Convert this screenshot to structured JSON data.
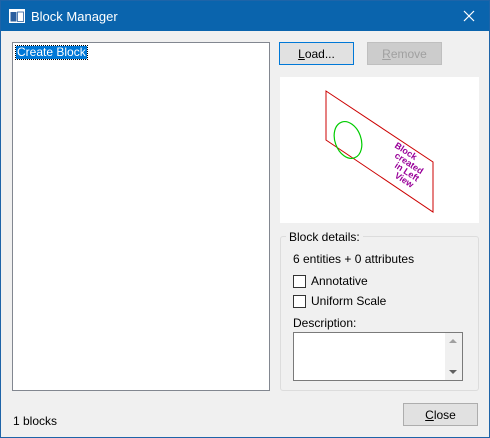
{
  "window": {
    "title": "Block Manager",
    "accent_color": "#0a64ad",
    "title_icon": "window-icon",
    "close_icon": "close-icon"
  },
  "blocks_list": {
    "items": [
      {
        "label": "Create Block",
        "selected": true
      }
    ]
  },
  "buttons": {
    "load": {
      "label_prefix": "",
      "label_mnemonic": "L",
      "label_rest": "oad..."
    },
    "remove": {
      "label_prefix": "",
      "label_mnemonic": "R",
      "label_rest": "emove",
      "enabled": false
    },
    "close": {
      "label_prefix": "",
      "label_mnemonic": "C",
      "label_rest": "lose"
    }
  },
  "preview": {
    "text": [
      "Block",
      "created",
      "in Left",
      "View"
    ],
    "border_color": "#cc0000",
    "circle_color": "#00cc00",
    "text_color": "#990099"
  },
  "details": {
    "group_label": "Block details:",
    "stats": "6 entities + 0 attributes",
    "annotative_label": "Annotative",
    "annotative_checked": false,
    "uniform_scale_label": "Uniform Scale",
    "uniform_scale_checked": false,
    "description_label": "Description:",
    "description_value": ""
  },
  "status": {
    "text": "1 blocks"
  }
}
